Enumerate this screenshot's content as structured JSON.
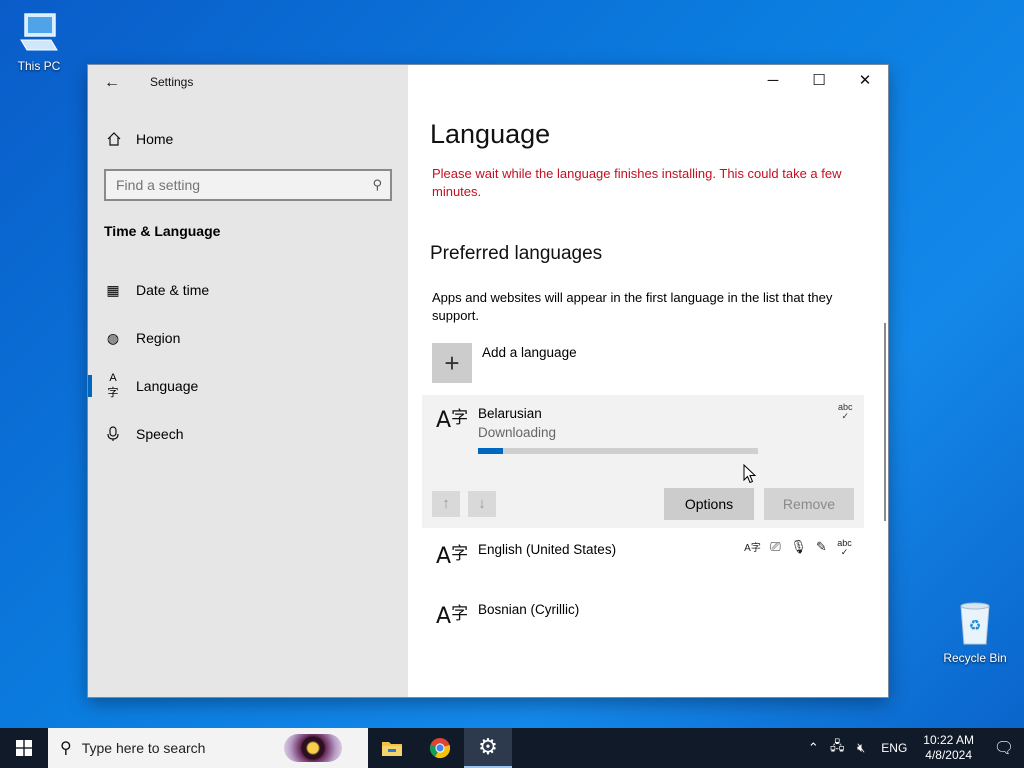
{
  "desktop": {
    "icons": [
      {
        "label": "This PC"
      },
      {
        "label": "Recycle Bin"
      }
    ]
  },
  "window": {
    "title": "Settings",
    "controls": {
      "minimize": "─",
      "maximize": "☐",
      "close": "✕"
    }
  },
  "sidebar": {
    "home_label": "Home",
    "search_placeholder": "Find a setting",
    "section_title": "Time & Language",
    "items": [
      {
        "label": "Date & time",
        "icon": "calendar-clock-icon"
      },
      {
        "label": "Region",
        "icon": "globe-icon"
      },
      {
        "label": "Language",
        "icon": "language-icon",
        "active": true
      },
      {
        "label": "Speech",
        "icon": "microphone-icon"
      }
    ]
  },
  "main": {
    "title": "Language",
    "warning": "Please wait while the language finishes installing. This could take a few minutes.",
    "preferred_heading": "Preferred languages",
    "preferred_desc": "Apps and websites will appear in the first language in the list that they support.",
    "add_language_label": "Add a language",
    "languages": [
      {
        "name": "Belarusian",
        "status": "Downloading",
        "progress": 0.09,
        "selected": true
      },
      {
        "name": "English (United States)"
      },
      {
        "name": "Bosnian (Cyrillic)"
      }
    ],
    "options_label": "Options",
    "remove_label": "Remove",
    "accent_color": "#0067c0",
    "warning_color": "#c50f1f"
  },
  "taskbar": {
    "search_placeholder": "Type here to search",
    "tray_language": "ENG",
    "time": "10:22 AM",
    "date": "4/8/2024"
  }
}
